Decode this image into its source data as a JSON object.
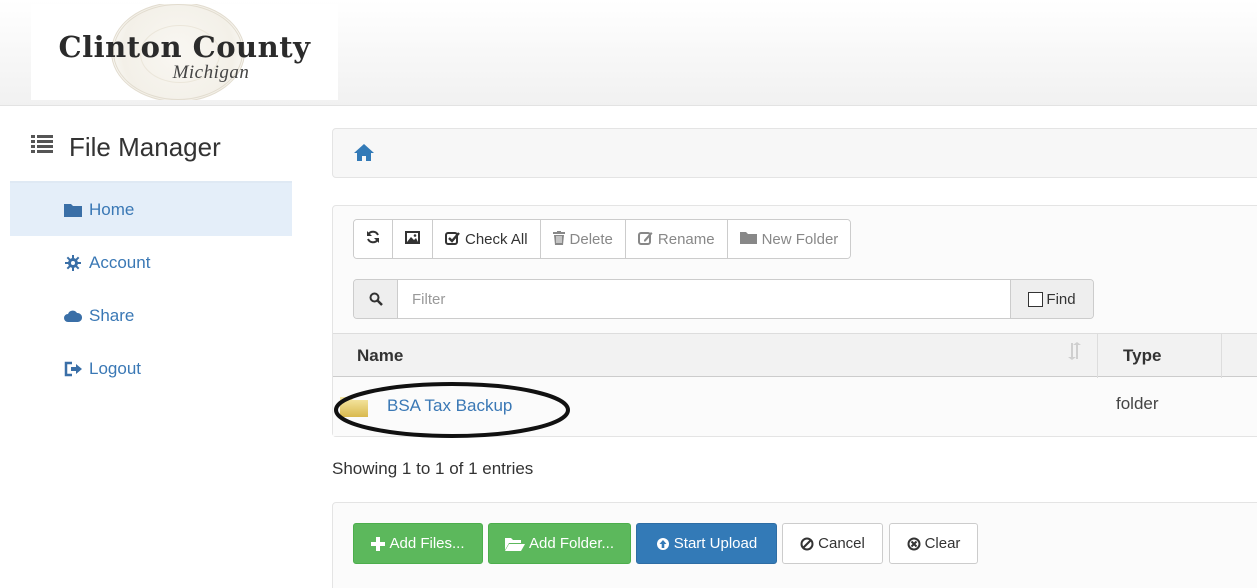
{
  "header": {
    "logo_title": "Clinton County",
    "logo_subtitle": "Michigan"
  },
  "sidebar": {
    "title": "File Manager",
    "items": [
      {
        "label": "Home",
        "icon": "folder-icon",
        "active": true
      },
      {
        "label": "Account",
        "icon": "gear-icon",
        "active": false
      },
      {
        "label": "Share",
        "icon": "cloud-icon",
        "active": false
      },
      {
        "label": "Logout",
        "icon": "logout-icon",
        "active": false
      }
    ]
  },
  "breadcrumb": {
    "icon": "home-icon"
  },
  "toolbar": {
    "check_all": "Check All",
    "delete": "Delete",
    "rename": "Rename",
    "new_folder": "New Folder"
  },
  "filter": {
    "placeholder": "Filter",
    "find_label": "Find"
  },
  "table": {
    "columns": [
      "Name",
      "Type"
    ],
    "rows": [
      {
        "name": "BSA Tax Backup",
        "type": "folder"
      }
    ],
    "info": "Showing 1 to 1 of 1 entries"
  },
  "upload": {
    "add_files": "Add Files...",
    "add_folder": "Add Folder...",
    "start_upload": "Start Upload",
    "cancel": "Cancel",
    "clear": "Clear"
  },
  "colors": {
    "link": "#3a78b5",
    "success": "#5cb85c",
    "primary": "#337ab7",
    "active_nav": "#e4eef9"
  }
}
